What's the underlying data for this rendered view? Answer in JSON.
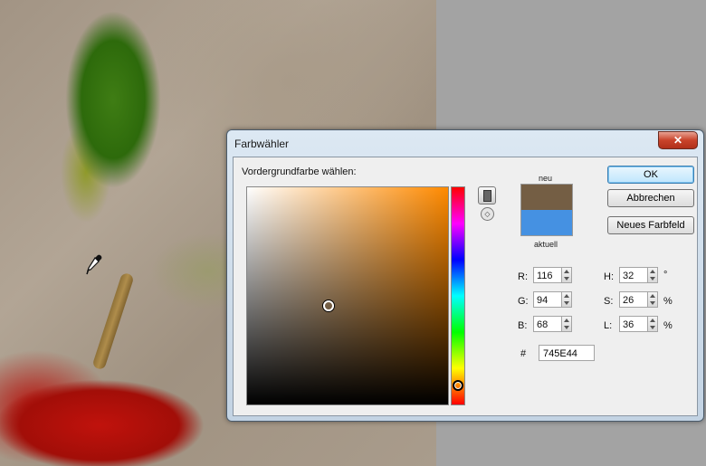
{
  "dialog": {
    "title": "Farbwähler",
    "close_label": "✕",
    "foreground_label": "Vordergrundfarbe wählen:",
    "new_label": "neu",
    "current_label": "aktuell",
    "new_color": "#745E44",
    "current_color": "#4591E2",
    "buttons": {
      "ok": "OK",
      "cancel": "Abbrechen",
      "new_swatch": "Neues Farbfeld"
    },
    "rgb": {
      "r_label": "R:",
      "r": "116",
      "g_label": "G:",
      "g": "94",
      "b_label": "B:",
      "b": "68"
    },
    "hsl": {
      "h_label": "H:",
      "h": "32",
      "h_unit": "°",
      "s_label": "S:",
      "s": "26",
      "s_unit": "%",
      "l_label": "L:",
      "l": "36",
      "l_unit": "%"
    },
    "hex_label": "#",
    "hex": "745E44",
    "hue_color": "#FF8A00"
  }
}
